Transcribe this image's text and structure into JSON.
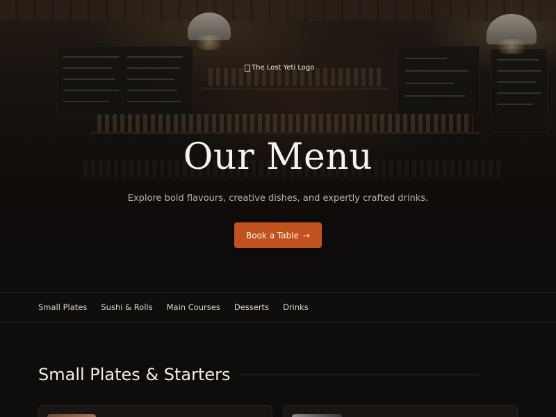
{
  "hero": {
    "logo_alt": "The Lost Yeti Logo",
    "title": "Our Menu",
    "subtitle": "Explore bold flavours, creative dishes, and expertly crafted drinks.",
    "cta_label": "Book a Table",
    "cta_icon": "arrow-right-icon"
  },
  "nav": {
    "tabs": [
      {
        "label": "Small Plates"
      },
      {
        "label": "Sushi & Rolls"
      },
      {
        "label": "Main Courses"
      },
      {
        "label": "Desserts"
      },
      {
        "label": "Drinks"
      }
    ]
  },
  "section": {
    "title": "Small Plates & Starters"
  },
  "colors": {
    "accent": "#c2521d",
    "background": "#0f0d0c",
    "text": "#f2ede6"
  }
}
